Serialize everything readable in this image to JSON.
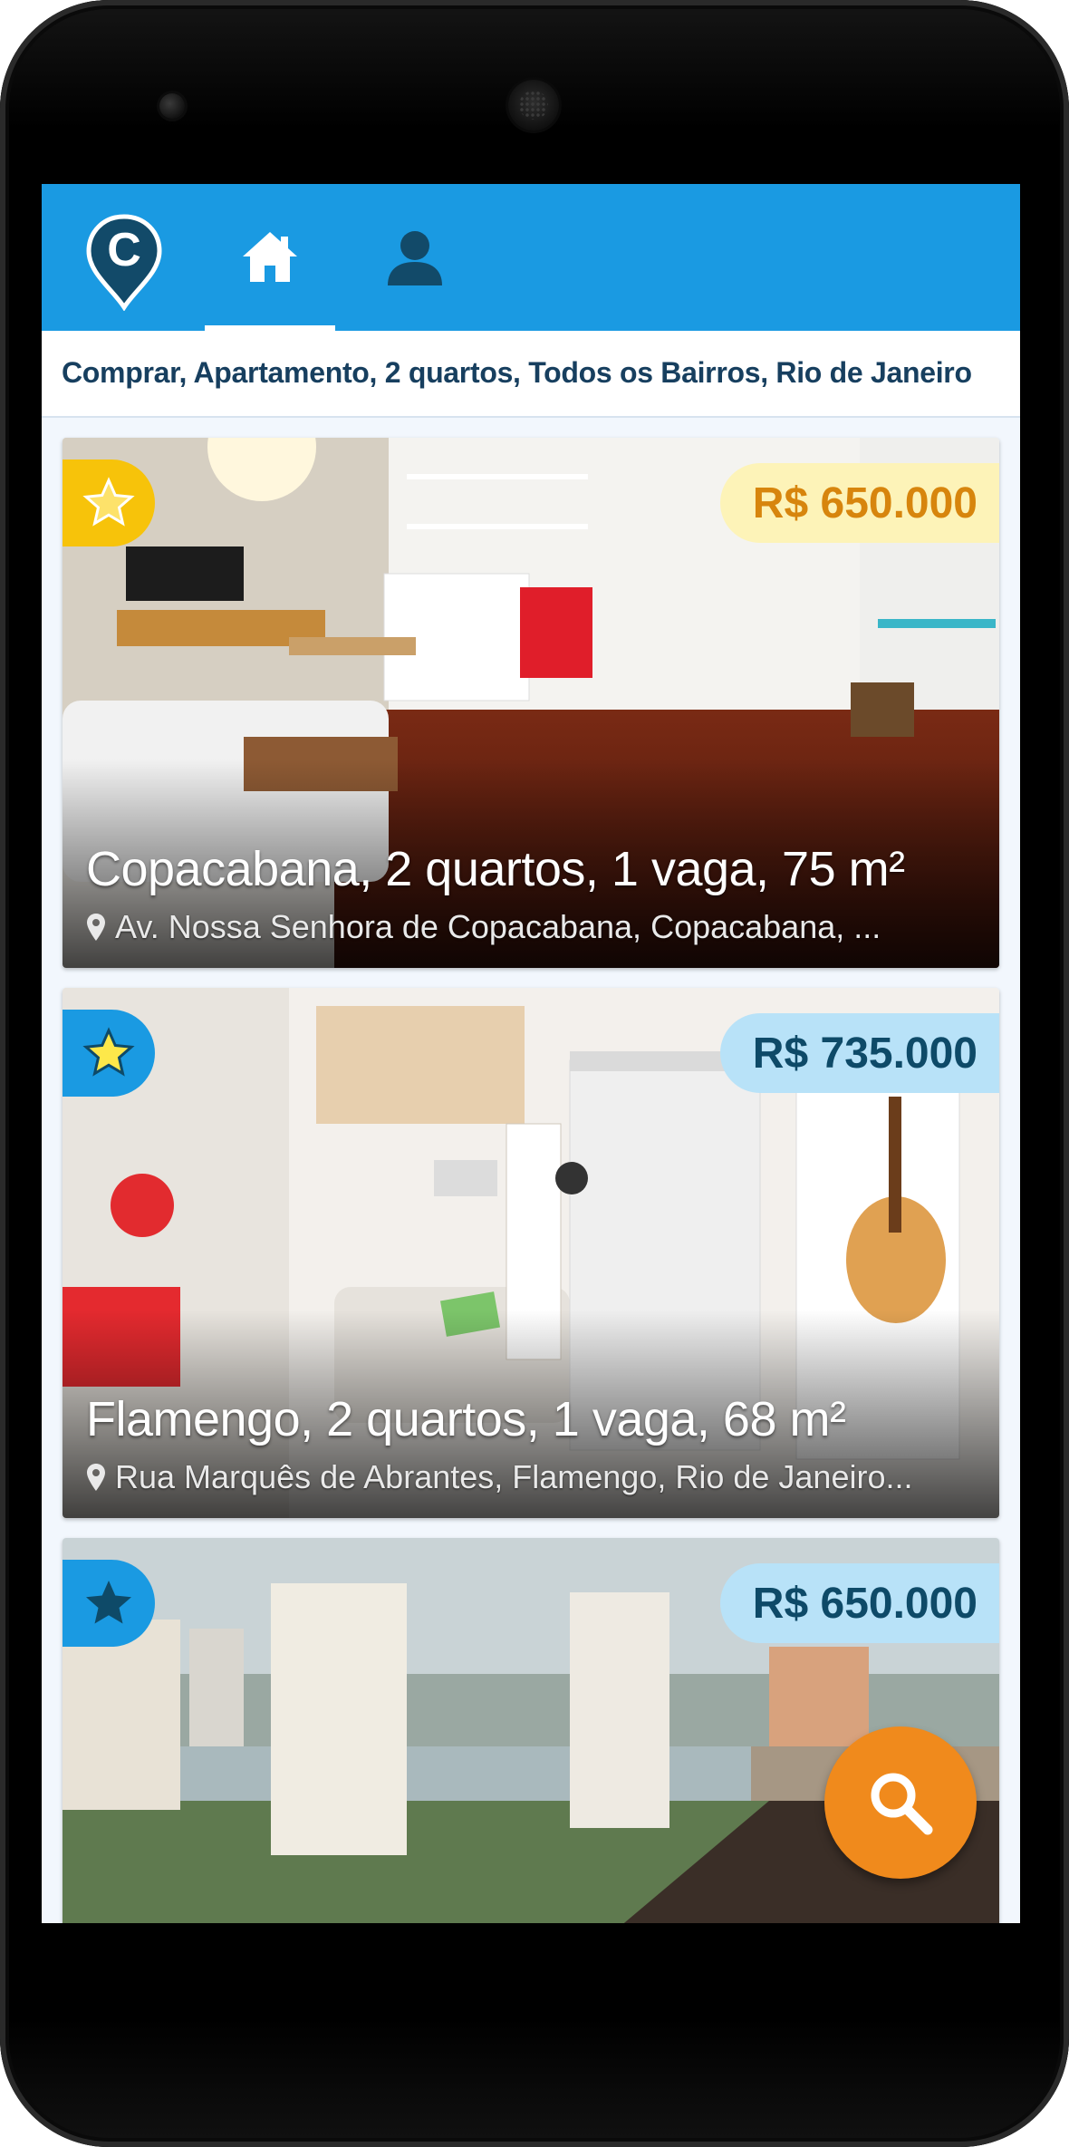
{
  "app": {
    "logo_letter": "C",
    "nav": [
      {
        "id": "home",
        "icon": "home-icon",
        "active": true
      },
      {
        "id": "profile",
        "icon": "person-icon",
        "active": false
      }
    ]
  },
  "filters": {
    "summary": "Comprar, Apartamento, 2 quartos, Todos os Bairros, Rio de Janeiro"
  },
  "colors": {
    "appbar": "#1a9ae2",
    "fab": "#f08a1c",
    "featured_yellow": "#f7c30a",
    "featured_blue": "#1a9ae2",
    "price_yellow_bg": "#fdf3b8",
    "price_yellow_text": "#d7850d",
    "price_blue_bg": "#b8e2f8",
    "price_blue_text": "#0e4a68"
  },
  "listings": [
    {
      "price": "R$ 650.000",
      "price_style": "yellow",
      "star_style": "yellow",
      "title": "Copacabana, 2 quartos, 1 vaga, 75 m²",
      "address": "Av. Nossa Senhora de Copacabana, Copacabana, ..."
    },
    {
      "price": "R$ 735.000",
      "price_style": "blue",
      "star_style": "blue-yellow",
      "title": "Flamengo, 2 quartos, 1 vaga, 68 m²",
      "address": "Rua Marquês de Abrantes, Flamengo, Rio de Janeiro..."
    },
    {
      "price": "R$ 650.000",
      "price_style": "blue",
      "star_style": "blue",
      "title": "",
      "address": ""
    }
  ],
  "fab": {
    "icon": "search-icon"
  }
}
